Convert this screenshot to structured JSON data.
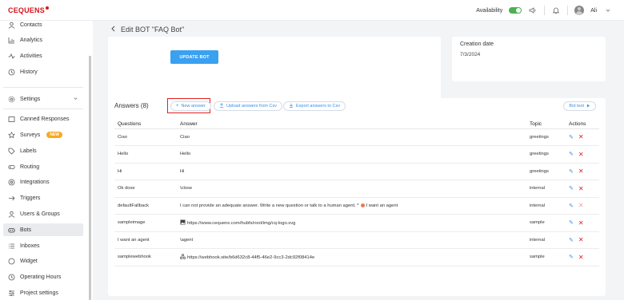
{
  "topbar": {
    "logo": "CEQUENS",
    "availability_label": "Availability",
    "user_name": "Ali"
  },
  "sidebar": {
    "items": [
      {
        "label": "Contacts",
        "icon": "contacts-icon"
      },
      {
        "label": "Analytics",
        "icon": "analytics-icon"
      },
      {
        "label": "Activities",
        "icon": "activities-icon"
      },
      {
        "label": "History",
        "icon": "history-icon"
      },
      {
        "label": "Settings",
        "icon": "settings-icon"
      },
      {
        "label": "Canned Responses",
        "icon": "canned-responses-icon"
      },
      {
        "label": "Surveys",
        "icon": "surveys-icon",
        "badge": "NEW"
      },
      {
        "label": "Labels",
        "icon": "labels-icon"
      },
      {
        "label": "Routing",
        "icon": "routing-icon"
      },
      {
        "label": "Integrations",
        "icon": "integrations-icon"
      },
      {
        "label": "Triggers",
        "icon": "triggers-icon"
      },
      {
        "label": "Users & Groups",
        "icon": "users-icon"
      },
      {
        "label": "Bots",
        "icon": "bots-icon",
        "active": true
      },
      {
        "label": "Inboxes",
        "icon": "inboxes-icon"
      },
      {
        "label": "Widget",
        "icon": "widget-icon"
      },
      {
        "label": "Operating Hours",
        "icon": "clock-icon"
      },
      {
        "label": "Project settings",
        "icon": "project-settings-icon"
      }
    ]
  },
  "main": {
    "page_title": "Edit BOT \"FAQ Bot\"",
    "update_button": "UPDATE BOT",
    "creation_date_label": "Creation date",
    "creation_date_value": "7/3/2024",
    "answers_title": "Answers (8)",
    "new_answer": "New answer",
    "upload_csv": "Upload answers from Csv",
    "export_csv": "Export answers to Csv",
    "bot_test": "Bot test",
    "columns": {
      "questions": "Questions",
      "answer": "Answer",
      "topic": "Topic",
      "actions": "Actions"
    },
    "rows": [
      {
        "question": "Ciao",
        "answer": "Ciao",
        "topic": "greetings"
      },
      {
        "question": "Hello",
        "answer": "Hello",
        "topic": "greetings"
      },
      {
        "question": "Hi",
        "answer": "Hi",
        "topic": "greetings"
      },
      {
        "question": "Ok dose",
        "answer": "\\close",
        "topic": "internal"
      },
      {
        "question": "defaultFallback",
        "answer_a": "I can not provide an adequate answer. Write a new question or talk to a human agent. *",
        "answer_b": "I want an agent",
        "topic": "internal"
      },
      {
        "question": "sampleimage",
        "answer": "https://www.cequens.com/hubfs/root/img/cq-logo.svg",
        "topic": "sample"
      },
      {
        "question": "I want an agent",
        "answer": "\\agent",
        "topic": "internal"
      },
      {
        "question": "samplewebhook",
        "answer": "https://webhook.site/b6d632c8-44f5-46e2-9cc3-2dc92f08414e",
        "topic": "sample"
      }
    ]
  },
  "colors": {
    "brand_red": "#d6151c",
    "accent_blue": "#3aa0f0",
    "highlight_red": "#e02020",
    "toggle_green": "#4caf50",
    "badge_orange": "#f7a823"
  }
}
